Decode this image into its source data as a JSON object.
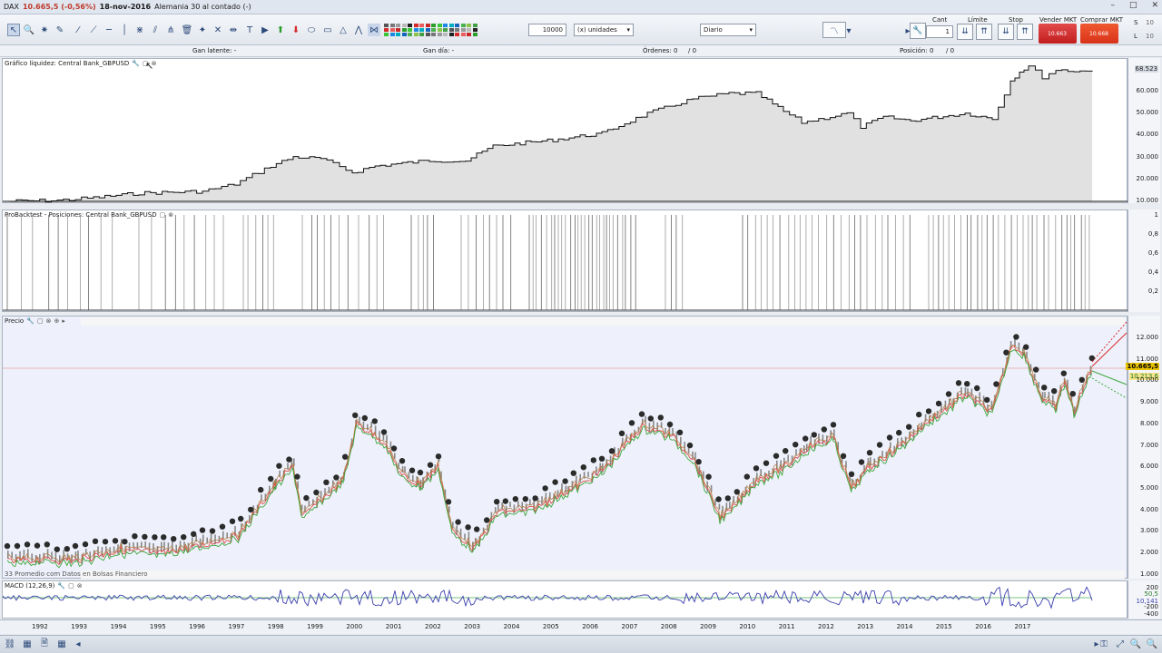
{
  "titlebar": {
    "instrument": "DAX",
    "price": "10.665,5 (-0,56%)",
    "date": "18-nov-2016",
    "market": "Alemania 30 al contado (-)"
  },
  "toolbar": {
    "quantity": "10000",
    "units": "(x) unidades",
    "timeframe": "Diario",
    "labels": {
      "cant": "Cant",
      "limite": "Límite",
      "stop": "Stop",
      "sell": "Vender MKT",
      "buy": "Comprar MKT"
    },
    "cant_value": "1",
    "sell_price": "10.663",
    "sell_big": "63",
    "buy_price": "10.668",
    "buy_big": "68",
    "side_s": "S",
    "side_l": "L",
    "side_s_val": "10",
    "side_l_val": "10"
  },
  "stats": {
    "gain_latent": "Gan latente: -",
    "gain_day": "Gan día: -",
    "orders": "Órdenes: 0",
    "orders_total": "/ 0",
    "position": "Posición: 0",
    "position_total": "/ 0"
  },
  "panels": {
    "equity_title": "Gráfico líquidez: Central Bank_GBPUSD",
    "positions_title": "ProBacktest - Posiciones: Central Bank_GBPUSD",
    "price_title": "Precio",
    "macd_title": "MACD (12,26,9)",
    "overlay_text": "33 Promedio com Datos en Bolsas Financiero"
  },
  "axes": {
    "equity": [
      "60.000",
      "50.000",
      "40.000",
      "30.000",
      "20.000",
      "10.000"
    ],
    "equity_top": "68.523",
    "positions": [
      "1",
      "0,8",
      "0,6",
      "0,4",
      "0,2"
    ],
    "price": [
      "12.000",
      "11.000",
      "10.000",
      "9.000",
      "8.000",
      "7.000",
      "6.000",
      "5.000",
      "4.000",
      "3.000",
      "2.000",
      "1.000"
    ],
    "price_marker": "10.665,5",
    "price_marker2": "10.213,6",
    "macd": [
      "200",
      "-200",
      "-400"
    ],
    "macd_vals": [
      "50,5",
      "10,141"
    ],
    "years": [
      "1992",
      "1993",
      "1994",
      "1995",
      "1996",
      "1997",
      "1998",
      "1999",
      "2000",
      "2001",
      "2002",
      "2003",
      "2004",
      "2005",
      "2006",
      "2007",
      "2008",
      "2009",
      "2010",
      "2011",
      "2012",
      "2013",
      "2014",
      "2015",
      "2016",
      "2017"
    ]
  },
  "colors": {
    "price_marker": "#e8c200",
    "sell": "#d62b2b",
    "buy": "#e03a1e",
    "equity_fill": "#e1e1e1",
    "macd_line": "#3b3fae"
  },
  "icons": [
    "cursor-icon",
    "zoom-icon",
    "crosshair-icon",
    "ruler-icon",
    "trendline-icon",
    "fibonacci-icon",
    "trash-icon",
    "arrow-up-icon",
    "arrow-down-icon",
    "rectangle-icon",
    "triangle-icon"
  ]
}
